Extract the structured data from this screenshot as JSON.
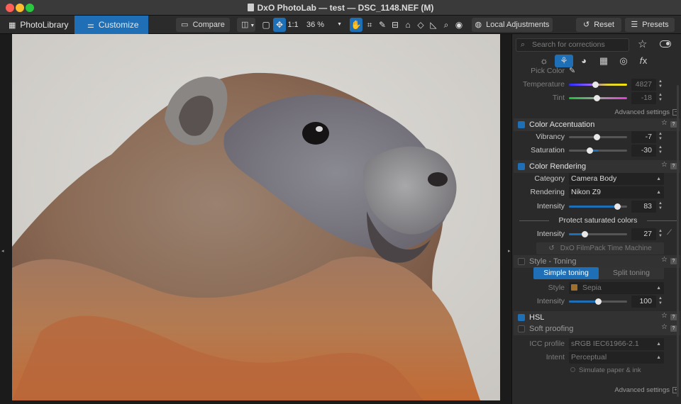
{
  "window": {
    "title": "DxO PhotoLab — test — DSC_1148.NEF (M)"
  },
  "toolbar": {
    "photolibrary": "PhotoLibrary",
    "customize": "Customize",
    "compare": "Compare",
    "zoom_fit": "1:1",
    "zoom_value": "36 %",
    "local_adjustments": "Local Adjustments",
    "reset": "Reset",
    "presets": "Presets"
  },
  "panel": {
    "search_placeholder": "Search for corrections",
    "pick_color_label": "Pick Color",
    "temperature": {
      "label": "Temperature",
      "value": "4827",
      "level": 0.45
    },
    "tint": {
      "label": "Tint",
      "value": "-18",
      "level": 0.47
    },
    "advanced_settings": "Advanced settings",
    "color_accentuation": {
      "title": "Color Accentuation",
      "vibrancy": {
        "label": "Vibrancy",
        "value": "-7",
        "level": 0.47
      },
      "saturation": {
        "label": "Saturation",
        "value": "-30",
        "level": 0.35
      }
    },
    "color_rendering": {
      "title": "Color Rendering",
      "category_label": "Category",
      "category_value": "Camera Body",
      "rendering_label": "Rendering",
      "rendering_value": "Nikon Z9",
      "intensity_label": "Intensity",
      "intensity_value": "83",
      "intensity_level": 0.83,
      "protect_label": "Protect saturated colors",
      "protect_intensity_label": "Intensity",
      "protect_intensity_value": "27",
      "protect_level": 0.27,
      "filmpack_label": "DxO FilmPack Time Machine"
    },
    "style_toning": {
      "title": "Style - Toning",
      "simple": "Simple toning",
      "split": "Split toning",
      "style_label": "Style",
      "style_value": "Sepia",
      "style_color": "#a0702a",
      "intensity_label": "Intensity",
      "intensity_value": "100",
      "intensity_level": 0.5
    },
    "hsl": {
      "title": "HSL"
    },
    "soft_proofing": {
      "title": "Soft proofing",
      "icc_label": "ICC profile",
      "icc_value": "sRGB IEC61966-2.1",
      "intent_label": "Intent",
      "intent_value": "Perceptual",
      "simulate_label": "Simulate paper & ink"
    },
    "advanced_settings_bottom": "Advanced settings"
  },
  "colors": {
    "accent": "#1e6fb5",
    "panel_bg": "#2a2a2a"
  }
}
